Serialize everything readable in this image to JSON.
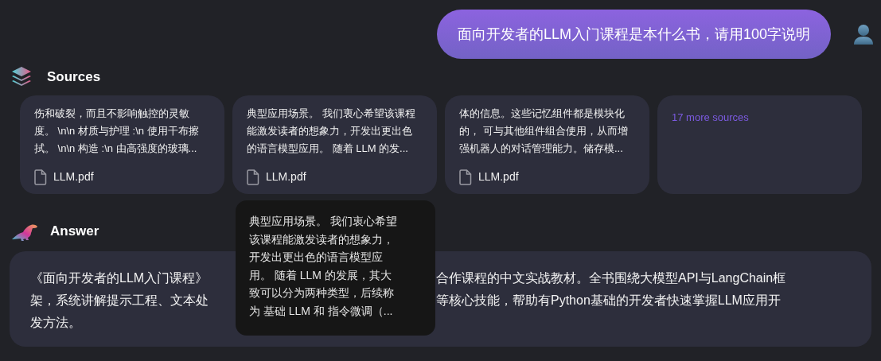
{
  "user_message": {
    "text": "面向开发者的LLM入门课程是本什么书，请用100字说明"
  },
  "sources": {
    "title": "Sources",
    "items": [
      {
        "kind": "document",
        "lines": [
          "伤和破裂，而且不影响触控的灵敏",
          "度。 \\n\\n 材质与护理 :\\n 使用干布擦",
          "拭。 \\n\\n 构造 :\\n 由高强度的玻璃..."
        ],
        "file": "LLM.pdf"
      },
      {
        "kind": "document",
        "lines": [
          "典型应用场景。 我们衷心希望该课程",
          "能激发读者的想象力，开发出更出色",
          "的语言模型应用。 随着 LLM 的发..."
        ],
        "file": "LLM.pdf"
      },
      {
        "kind": "document",
        "lines": [
          "体的信息。这些记忆组件都是模块化",
          "的， 可与其他组件组合使用，从而增",
          "强机器人的对话管理能力。储存模..."
        ],
        "file": "LLM.pdf"
      },
      {
        "kind": "more",
        "label": "17 more sources"
      }
    ]
  },
  "answer": {
    "title": "Answer",
    "lines": [
      {
        "left": "《面向开发者的LLM入门课程》",
        "right": "合作课程的中文实战教材。全书围绕大模型API与LangChain框"
      },
      {
        "left": "架，系统讲解提示工程、文本处",
        "right": "等核心技能，帮助有Python基础的开发者快速掌握LLM应用开"
      },
      {
        "left": "发方法。"
      }
    ]
  },
  "tooltip": {
    "lines": [
      "典型应用场景。 我们衷心希望",
      "该课程能激发读者的想象力，",
      "开发出更出色的语言模型应",
      "用。 随着 LLM 的发展，其大",
      "致可以分为两种类型，后续称",
      "为 基础 LLM 和 指令微调（..."
    ]
  }
}
